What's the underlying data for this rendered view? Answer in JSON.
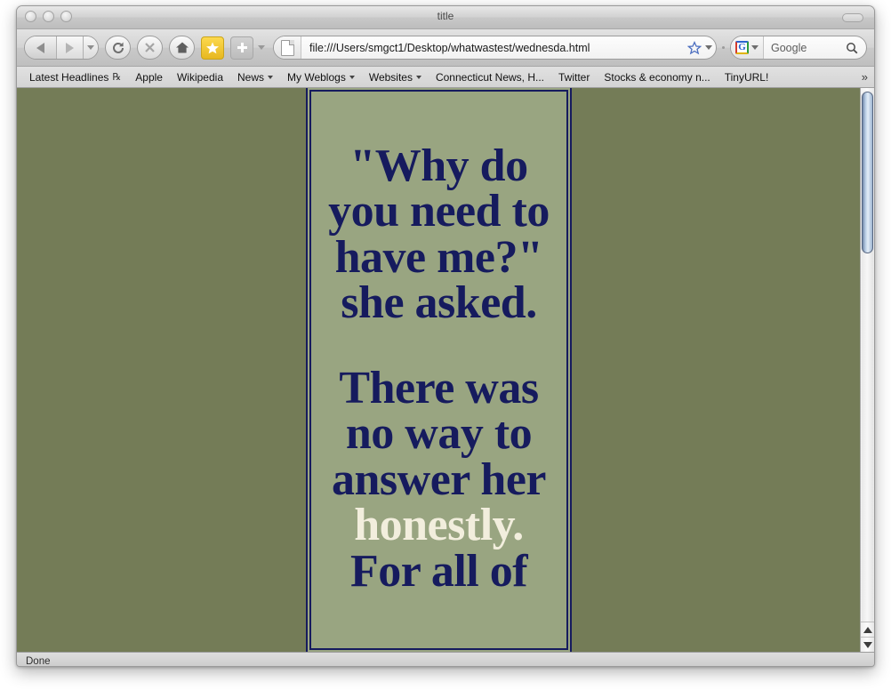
{
  "window": {
    "title": "title",
    "controls": [
      "close",
      "minimize",
      "zoom"
    ]
  },
  "toolbar": {
    "back_icon": "back-arrow-icon",
    "forward_icon": "forward-arrow-icon",
    "history_dropdown_icon": "chevron-down-icon",
    "reload_icon": "reload-icon",
    "stop_icon": "stop-x-icon",
    "home_icon": "home-icon",
    "bookmark_star_icon": "star-icon",
    "add_icon": "plus-icon",
    "add_dropdown_icon": "chevron-down-icon"
  },
  "url_bar": {
    "page_icon": "document-icon",
    "value": "file:///Users/smgct1/Desktop/whatwastest/wednesda.html",
    "star_icon": "star-outline-icon",
    "star_dropdown_icon": "chevron-down-icon"
  },
  "search_bar": {
    "engine": "G",
    "engine_icon": "google-logo-icon",
    "engine_dropdown_icon": "chevron-down-icon",
    "placeholder": "Google",
    "magnifier_icon": "search-icon"
  },
  "bookmarks": {
    "items": [
      {
        "label": "Latest Headlines",
        "icon": "rss-icon",
        "has_dropdown": false
      },
      {
        "label": "Apple",
        "icon": null,
        "has_dropdown": false
      },
      {
        "label": "Wikipedia",
        "icon": null,
        "has_dropdown": false
      },
      {
        "label": "News",
        "icon": null,
        "has_dropdown": true
      },
      {
        "label": "My Weblogs",
        "icon": null,
        "has_dropdown": true
      },
      {
        "label": "Websites",
        "icon": null,
        "has_dropdown": true
      },
      {
        "label": "Connecticut News, H...",
        "icon": null,
        "has_dropdown": false
      },
      {
        "label": "Twitter",
        "icon": null,
        "has_dropdown": false
      },
      {
        "label": "Stocks & economy n...",
        "icon": null,
        "has_dropdown": false
      },
      {
        "label": "TinyURL!",
        "icon": null,
        "has_dropdown": false
      }
    ],
    "overflow_label": "»"
  },
  "page": {
    "background_color": "#747c57",
    "frame_color": "#99a581",
    "border_color": "#161b5e",
    "text_color": "#161b5e",
    "highlight_color": "#f2eedd",
    "paragraph1": "\"Why do you need to have me?\" she asked.",
    "paragraph2_before": "There was no way to answer her ",
    "paragraph2_highlight": "honestly.",
    "paragraph2_after": " For all of"
  },
  "scrollbar": {
    "up_arrow_icon": "arrow-up-icon",
    "down_arrow_icon": "arrow-down-icon"
  },
  "status_bar": {
    "text": "Done"
  }
}
